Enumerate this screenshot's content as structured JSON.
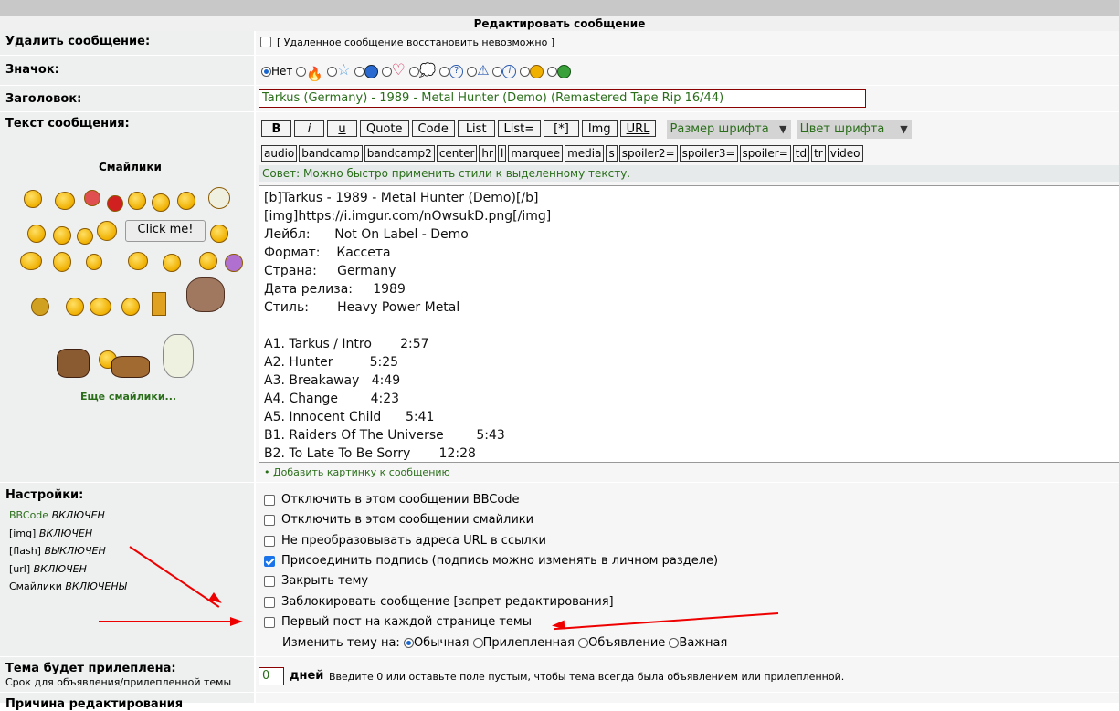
{
  "header": {
    "title": "Редактировать сообщение"
  },
  "delete": {
    "label": "Удалить сообщение:",
    "note": "[ Удаленное сообщение восстановить невозможно ]"
  },
  "icon": {
    "label": "Значок:",
    "none_label": "Нет",
    "options": [
      "fire-icon",
      "star-icon",
      "radiation-icon",
      "heart-icon",
      "speech-bubble-icon",
      "question-icon",
      "warning-icon",
      "info-icon",
      "shocked-face-icon",
      "grin-face-icon"
    ]
  },
  "subject": {
    "label": "Заголовок:",
    "value": "Tarkus (Germany) - 1989 - Metal Hunter (Demo) (Remastered Tape Rip 16/44)"
  },
  "body": {
    "label": "Текст сообщения:"
  },
  "smilies": {
    "title": "Смайлики",
    "more_link": "Еще смайлики...",
    "click_me": "Click me!"
  },
  "toolbar": {
    "row1": [
      "B",
      "i",
      "u",
      "Quote",
      "Code",
      "List",
      "List=",
      "[*]",
      "Img",
      "URL"
    ],
    "font_size": "Размер шрифта",
    "font_color": "Цвет шрифта",
    "row2": [
      "audio",
      "bandcamp",
      "bandcamp2",
      "center",
      "hr",
      "l",
      "marquee",
      "media",
      "s",
      "spoiler2=",
      "spoiler3=",
      "spoiler=",
      "td",
      "tr",
      "video"
    ],
    "hint": "Совет: Можно быстро применить стили к выделенному тексту."
  },
  "message_text": "[b]Tarkus - 1989 - Metal Hunter (Demo)[/b]\n[img]https://i.imgur.com/nOwsukD.png[/img]\nЛейбл:      Not On Label - Demo\nФормат:    Кассета\nСтрана:     Germany\nДата релиза:     1989\nСтиль:       Heavy Power Metal\n\nA1. Tarkus / Intro       2:57\nA2. Hunter         5:25\nA3. Breakaway   4:49\nA4. Change        4:23\nA5. Innocent Child      5:41\nB1. Raiders Of The Universe        5:43\nB2. To Late To Be Sorry       12:28",
  "add_image_link": "Добавить картинку к сообщению",
  "settings": {
    "label": "Настройки:",
    "status": [
      {
        "name": "BBCode",
        "state": "ВКЛЮЧЕН"
      },
      {
        "name": "[img]",
        "state": "ВКЛЮЧЕН"
      },
      {
        "name": "[flash]",
        "state": "ВЫКЛЮЧЕН"
      },
      {
        "name": "[url]",
        "state": "ВКЛЮЧЕН"
      },
      {
        "name": "Смайлики",
        "state": "ВКЛЮЧЕНЫ"
      }
    ],
    "options": [
      {
        "label": "Отключить в этом сообщении BBCode",
        "checked": false
      },
      {
        "label": "Отключить в этом сообщении смайлики",
        "checked": false
      },
      {
        "label": "Не преобразовывать адреса URL в ссылки",
        "checked": false
      },
      {
        "label": "Присоединить подпись (подпись можно изменять в личном разделе)",
        "checked": true
      },
      {
        "label": "Закрыть тему",
        "checked": false
      },
      {
        "label": "Заблокировать сообщение [запрет редактирования]",
        "checked": false
      },
      {
        "label": "Первый пост на каждой странице темы",
        "checked": false
      }
    ],
    "change_topic_label": "Изменить тему на:",
    "topic_types": [
      {
        "label": "Обычная",
        "selected": true
      },
      {
        "label": "Прилепленная",
        "selected": false
      },
      {
        "label": "Объявление",
        "selected": false
      },
      {
        "label": "Важная",
        "selected": false
      }
    ]
  },
  "sticky": {
    "label": "Тема будет прилеплена:",
    "sublabel": "Срок для объявления/прилепленной темы",
    "value": "0",
    "unit": "дней",
    "hint": "Введите 0 или оставьте поле пустым, чтобы тема всегда была объявлением или прилепленной."
  },
  "next_label": "Причина редактирования",
  "colors": {
    "green_text": "#2a6e1a",
    "red_border": "#8b0000",
    "arrow": "#e00000"
  }
}
